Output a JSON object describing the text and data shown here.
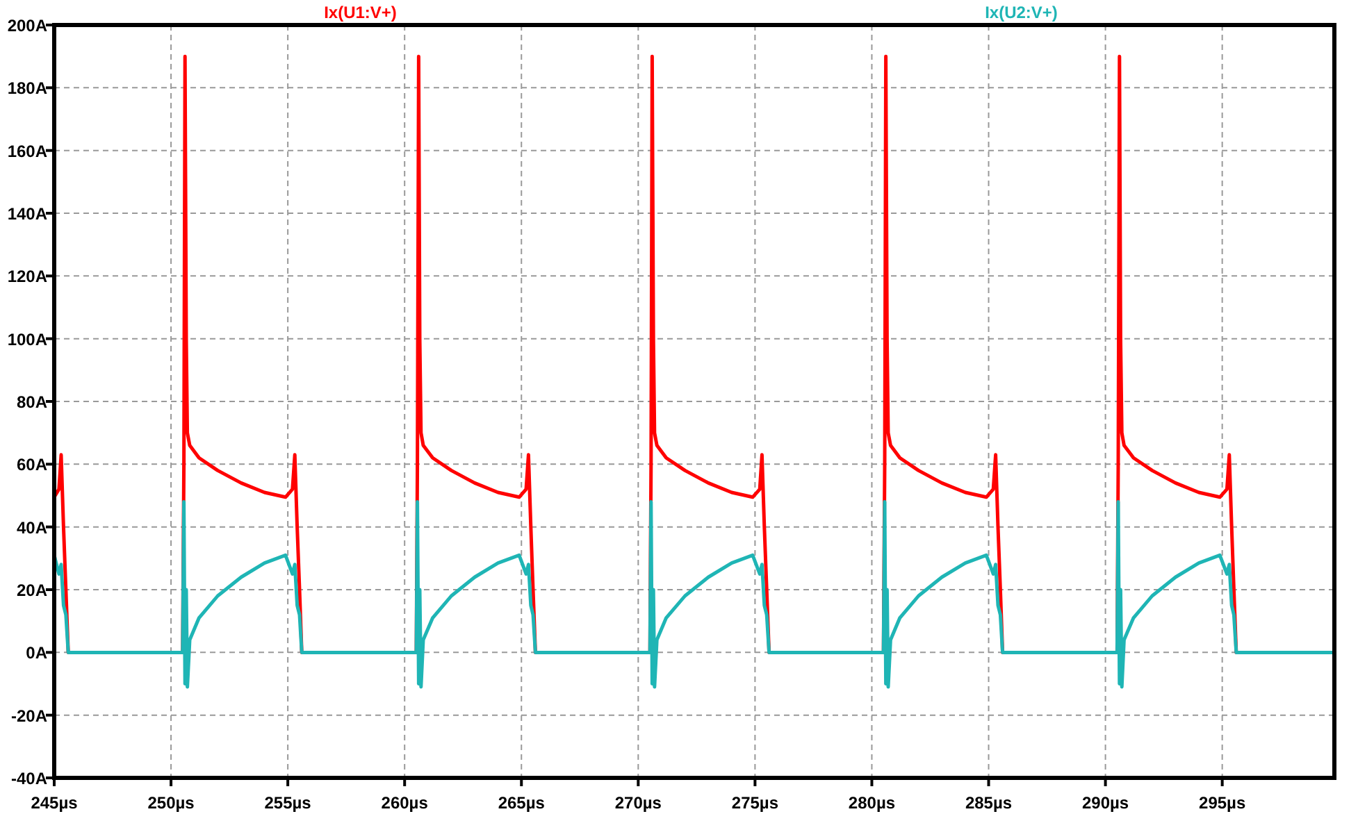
{
  "chart_data": {
    "type": "line",
    "grid": true,
    "x": [
      245,
      245.2,
      245.3,
      245.4,
      245.5,
      245.6,
      250.5,
      250.55,
      250.6,
      250.65,
      250.7,
      250.8,
      251.2,
      252,
      253,
      254,
      254.9,
      255.2,
      255.3,
      255.4,
      255.5,
      255.6,
      260.5,
      260.55,
      260.6,
      260.65,
      260.7,
      260.8,
      261.2,
      262,
      263,
      264,
      264.9,
      265.2,
      265.3,
      265.4,
      265.5,
      265.6,
      270.5,
      270.55,
      270.6,
      270.65,
      270.7,
      270.8,
      271.2,
      272,
      273,
      274,
      274.9,
      275.2,
      275.3,
      275.4,
      275.5,
      275.6,
      280.5,
      280.55,
      280.6,
      280.65,
      280.7,
      280.8,
      281.2,
      282,
      283,
      284,
      284.9,
      285.2,
      285.3,
      285.4,
      285.5,
      285.6,
      290.5,
      290.55,
      290.6,
      290.65,
      290.7,
      290.8,
      291.2,
      292,
      293,
      294,
      294.9,
      295.2,
      295.3,
      295.4,
      295.5,
      295.6,
      299.8
    ],
    "series": [
      {
        "name": "Ix(U1:V+)",
        "color": "#ff0000",
        "values": [
          49.5,
          52,
          63,
          40,
          20,
          0,
          0,
          60,
          190,
          100,
          70,
          66,
          62,
          58,
          54,
          51,
          49.5,
          52,
          63,
          40,
          20,
          0,
          0,
          60,
          190,
          100,
          70,
          66,
          62,
          58,
          54,
          51,
          49.5,
          52,
          63,
          40,
          20,
          0,
          0,
          60,
          190,
          100,
          70,
          66,
          62,
          58,
          54,
          51,
          49.5,
          52,
          63,
          40,
          20,
          0,
          0,
          60,
          190,
          100,
          70,
          66,
          62,
          58,
          54,
          51,
          49.5,
          52,
          63,
          40,
          20,
          0,
          0,
          60,
          190,
          100,
          70,
          66,
          62,
          58,
          54,
          51,
          49.5,
          52,
          63,
          40,
          20,
          0,
          0
        ]
      },
      {
        "name": "Ix(U2:V+)",
        "color": "#1fb5b5",
        "values": [
          31,
          25,
          28,
          15,
          12,
          0,
          0,
          48,
          -10,
          20,
          -11,
          4,
          11,
          18,
          24,
          28.5,
          31,
          25,
          28,
          15,
          12,
          0,
          0,
          48,
          -10,
          20,
          -11,
          4,
          11,
          18,
          24,
          28.5,
          31,
          25,
          28,
          15,
          12,
          0,
          0,
          48,
          -10,
          20,
          -11,
          4,
          11,
          18,
          24,
          28.5,
          31,
          25,
          28,
          15,
          12,
          0,
          0,
          48,
          -10,
          20,
          -11,
          4,
          11,
          18,
          24,
          28.5,
          31,
          25,
          28,
          15,
          12,
          0,
          0,
          48,
          -10,
          20,
          -11,
          4,
          11,
          18,
          24,
          28.5,
          31,
          25,
          28,
          15,
          12,
          0,
          0
        ]
      }
    ],
    "xlim": [
      245,
      299.8
    ],
    "ylim": [
      -40,
      200
    ],
    "xticks": [
      {
        "value": 245,
        "label": "245µs"
      },
      {
        "value": 250,
        "label": "250µs"
      },
      {
        "value": 255,
        "label": "255µs"
      },
      {
        "value": 260,
        "label": "260µs"
      },
      {
        "value": 265,
        "label": "265µs"
      },
      {
        "value": 270,
        "label": "270µs"
      },
      {
        "value": 275,
        "label": "275µs"
      },
      {
        "value": 280,
        "label": "280µs"
      },
      {
        "value": 285,
        "label": "285µs"
      },
      {
        "value": 290,
        "label": "290µs"
      },
      {
        "value": 295,
        "label": "295µs"
      }
    ],
    "yticks": [
      {
        "value": 200,
        "label": "200A"
      },
      {
        "value": 180,
        "label": "180A"
      },
      {
        "value": 160,
        "label": "160A"
      },
      {
        "value": 140,
        "label": "140A"
      },
      {
        "value": 120,
        "label": "120A"
      },
      {
        "value": 100,
        "label": "100A"
      },
      {
        "value": 80,
        "label": "80A"
      },
      {
        "value": 60,
        "label": "60A"
      },
      {
        "value": 40,
        "label": "40A"
      },
      {
        "value": 20,
        "label": "20A"
      },
      {
        "value": 0,
        "label": "0A"
      },
      {
        "value": -20,
        "label": "-20A"
      },
      {
        "value": -40,
        "label": "-40A"
      }
    ]
  }
}
